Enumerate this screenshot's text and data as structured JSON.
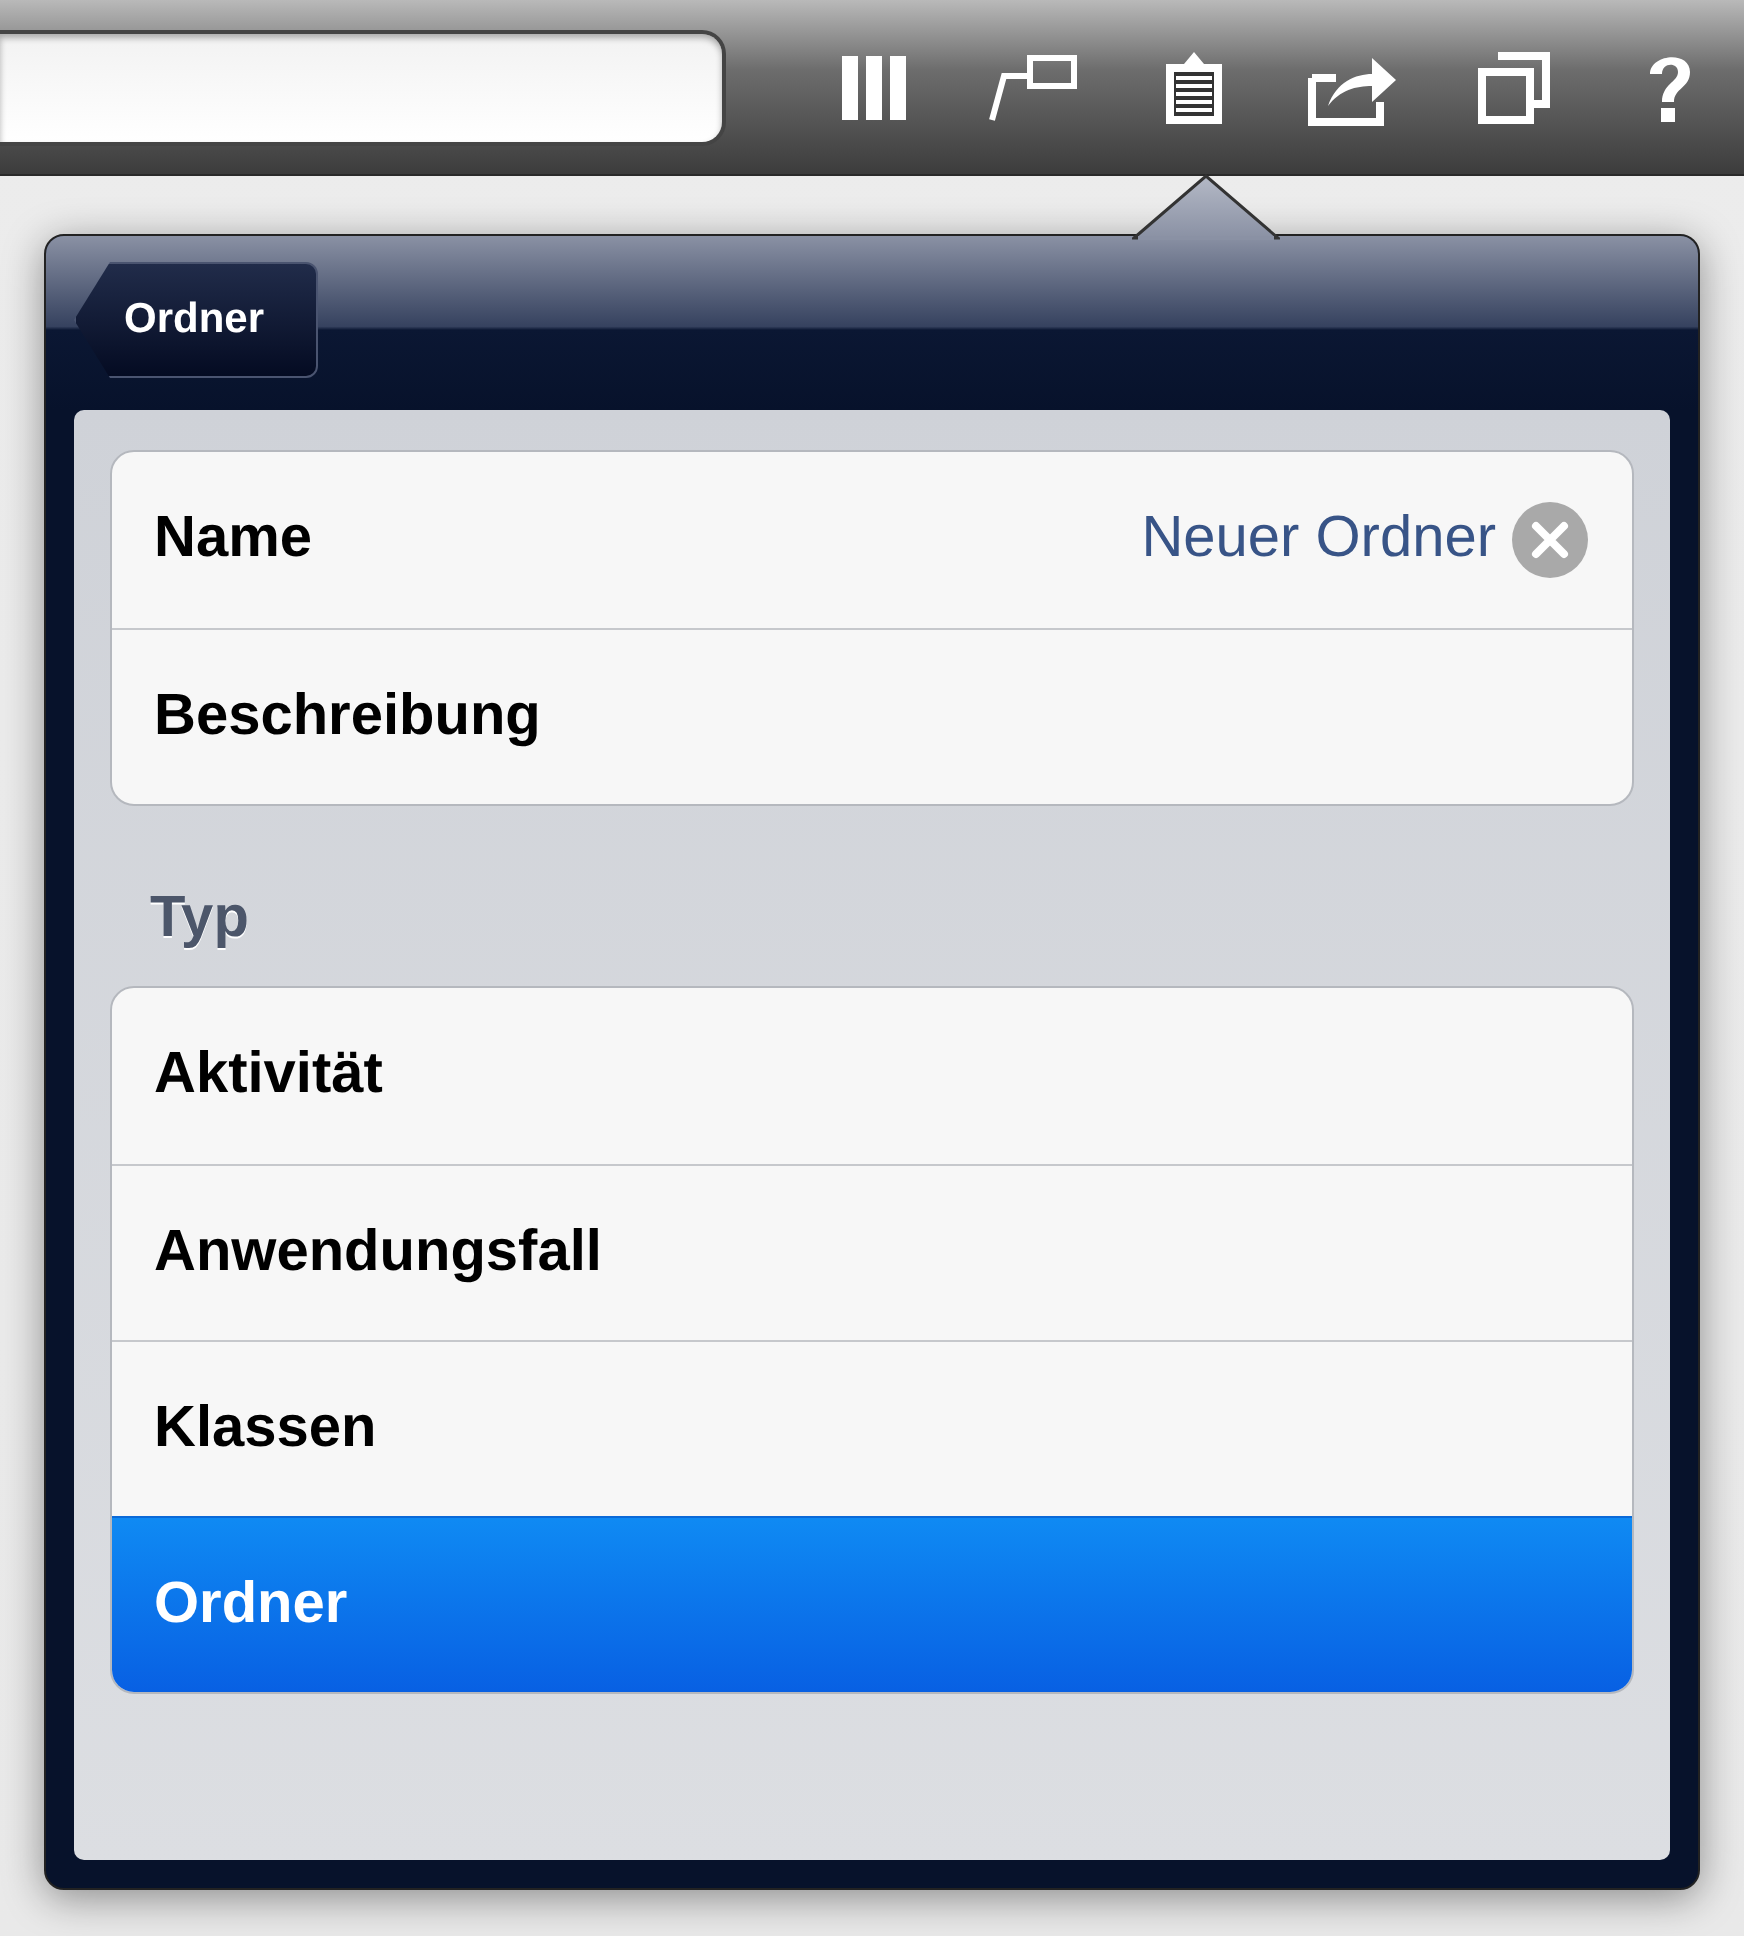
{
  "popover": {
    "back_button": "Ordner",
    "fields": [
      {
        "label": "Name",
        "value": "Neuer Ordner",
        "clear_button": true
      },
      {
        "label": "Beschreibung"
      }
    ],
    "type_section": {
      "title": "Typ",
      "options": [
        {
          "label": "Aktivität",
          "selected": false
        },
        {
          "label": "Anwendungsfall",
          "selected": false
        },
        {
          "label": "Klassen",
          "selected": false
        },
        {
          "label": "Ordner",
          "selected": true
        }
      ]
    }
  }
}
